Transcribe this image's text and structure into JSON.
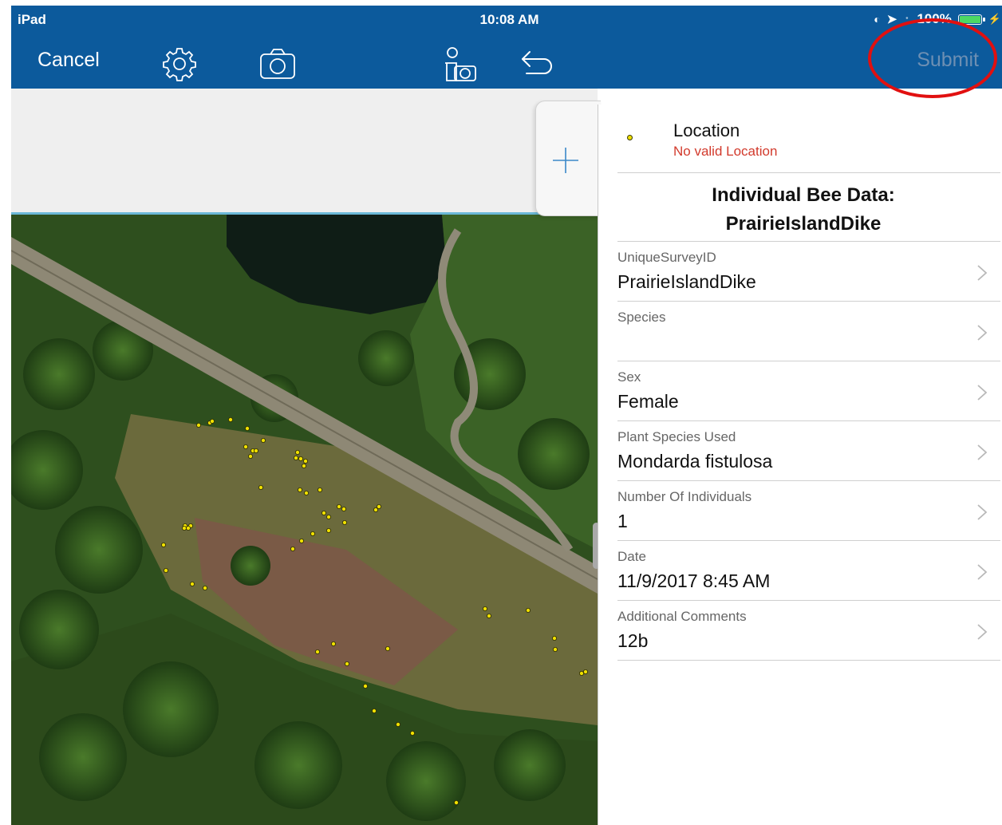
{
  "status_bar": {
    "device": "iPad",
    "time": "10:08 AM",
    "battery": "100%",
    "battery_level": 1.0
  },
  "toolbar": {
    "cancel_label": "Cancel",
    "submit_label": "Submit",
    "icons": [
      "gear-icon",
      "camera-icon",
      "collect-location-icon",
      "undo-icon"
    ]
  },
  "location": {
    "label": "Location",
    "status": "No valid Location"
  },
  "form": {
    "title": "Individual Bee Data:\nPrairieIslandDike",
    "fields": [
      {
        "label": "UniqueSurveyID",
        "value": "PrairieIslandDike"
      },
      {
        "label": "Species",
        "value": ""
      },
      {
        "label": "Sex",
        "value": "Female"
      },
      {
        "label": "Plant Species Used",
        "value": "Mondarda fistulosa"
      },
      {
        "label": "Number Of Individuals",
        "value": "1"
      },
      {
        "label": "Date",
        "value": "11/9/2017 8:45 AM"
      },
      {
        "label": "Additional Comments",
        "value": "12b"
      }
    ]
  },
  "colors": {
    "toolbar_bg": "#0c5a9c",
    "submit_disabled": "#6d8fb3",
    "error_text": "#d23a2c",
    "highlight_circle": "#e11010",
    "map_point": "#f0e000"
  }
}
